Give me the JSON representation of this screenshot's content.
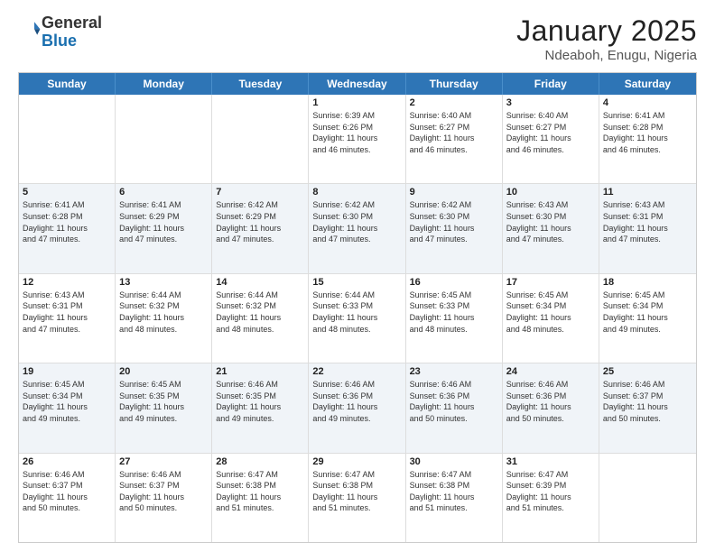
{
  "header": {
    "logo_line1": "General",
    "logo_line2": "Blue",
    "title": "January 2025",
    "subtitle": "Ndeaboh, Enugu, Nigeria"
  },
  "calendar": {
    "days_of_week": [
      "Sunday",
      "Monday",
      "Tuesday",
      "Wednesday",
      "Thursday",
      "Friday",
      "Saturday"
    ],
    "rows": [
      {
        "alt": false,
        "cells": [
          {
            "day": "",
            "info": ""
          },
          {
            "day": "",
            "info": ""
          },
          {
            "day": "",
            "info": ""
          },
          {
            "day": "1",
            "info": "Sunrise: 6:39 AM\nSunset: 6:26 PM\nDaylight: 11 hours\nand 46 minutes."
          },
          {
            "day": "2",
            "info": "Sunrise: 6:40 AM\nSunset: 6:27 PM\nDaylight: 11 hours\nand 46 minutes."
          },
          {
            "day": "3",
            "info": "Sunrise: 6:40 AM\nSunset: 6:27 PM\nDaylight: 11 hours\nand 46 minutes."
          },
          {
            "day": "4",
            "info": "Sunrise: 6:41 AM\nSunset: 6:28 PM\nDaylight: 11 hours\nand 46 minutes."
          }
        ]
      },
      {
        "alt": true,
        "cells": [
          {
            "day": "5",
            "info": "Sunrise: 6:41 AM\nSunset: 6:28 PM\nDaylight: 11 hours\nand 47 minutes."
          },
          {
            "day": "6",
            "info": "Sunrise: 6:41 AM\nSunset: 6:29 PM\nDaylight: 11 hours\nand 47 minutes."
          },
          {
            "day": "7",
            "info": "Sunrise: 6:42 AM\nSunset: 6:29 PM\nDaylight: 11 hours\nand 47 minutes."
          },
          {
            "day": "8",
            "info": "Sunrise: 6:42 AM\nSunset: 6:30 PM\nDaylight: 11 hours\nand 47 minutes."
          },
          {
            "day": "9",
            "info": "Sunrise: 6:42 AM\nSunset: 6:30 PM\nDaylight: 11 hours\nand 47 minutes."
          },
          {
            "day": "10",
            "info": "Sunrise: 6:43 AM\nSunset: 6:30 PM\nDaylight: 11 hours\nand 47 minutes."
          },
          {
            "day": "11",
            "info": "Sunrise: 6:43 AM\nSunset: 6:31 PM\nDaylight: 11 hours\nand 47 minutes."
          }
        ]
      },
      {
        "alt": false,
        "cells": [
          {
            "day": "12",
            "info": "Sunrise: 6:43 AM\nSunset: 6:31 PM\nDaylight: 11 hours\nand 47 minutes."
          },
          {
            "day": "13",
            "info": "Sunrise: 6:44 AM\nSunset: 6:32 PM\nDaylight: 11 hours\nand 48 minutes."
          },
          {
            "day": "14",
            "info": "Sunrise: 6:44 AM\nSunset: 6:32 PM\nDaylight: 11 hours\nand 48 minutes."
          },
          {
            "day": "15",
            "info": "Sunrise: 6:44 AM\nSunset: 6:33 PM\nDaylight: 11 hours\nand 48 minutes."
          },
          {
            "day": "16",
            "info": "Sunrise: 6:45 AM\nSunset: 6:33 PM\nDaylight: 11 hours\nand 48 minutes."
          },
          {
            "day": "17",
            "info": "Sunrise: 6:45 AM\nSunset: 6:34 PM\nDaylight: 11 hours\nand 48 minutes."
          },
          {
            "day": "18",
            "info": "Sunrise: 6:45 AM\nSunset: 6:34 PM\nDaylight: 11 hours\nand 49 minutes."
          }
        ]
      },
      {
        "alt": true,
        "cells": [
          {
            "day": "19",
            "info": "Sunrise: 6:45 AM\nSunset: 6:34 PM\nDaylight: 11 hours\nand 49 minutes."
          },
          {
            "day": "20",
            "info": "Sunrise: 6:45 AM\nSunset: 6:35 PM\nDaylight: 11 hours\nand 49 minutes."
          },
          {
            "day": "21",
            "info": "Sunrise: 6:46 AM\nSunset: 6:35 PM\nDaylight: 11 hours\nand 49 minutes."
          },
          {
            "day": "22",
            "info": "Sunrise: 6:46 AM\nSunset: 6:36 PM\nDaylight: 11 hours\nand 49 minutes."
          },
          {
            "day": "23",
            "info": "Sunrise: 6:46 AM\nSunset: 6:36 PM\nDaylight: 11 hours\nand 50 minutes."
          },
          {
            "day": "24",
            "info": "Sunrise: 6:46 AM\nSunset: 6:36 PM\nDaylight: 11 hours\nand 50 minutes."
          },
          {
            "day": "25",
            "info": "Sunrise: 6:46 AM\nSunset: 6:37 PM\nDaylight: 11 hours\nand 50 minutes."
          }
        ]
      },
      {
        "alt": false,
        "cells": [
          {
            "day": "26",
            "info": "Sunrise: 6:46 AM\nSunset: 6:37 PM\nDaylight: 11 hours\nand 50 minutes."
          },
          {
            "day": "27",
            "info": "Sunrise: 6:46 AM\nSunset: 6:37 PM\nDaylight: 11 hours\nand 50 minutes."
          },
          {
            "day": "28",
            "info": "Sunrise: 6:47 AM\nSunset: 6:38 PM\nDaylight: 11 hours\nand 51 minutes."
          },
          {
            "day": "29",
            "info": "Sunrise: 6:47 AM\nSunset: 6:38 PM\nDaylight: 11 hours\nand 51 minutes."
          },
          {
            "day": "30",
            "info": "Sunrise: 6:47 AM\nSunset: 6:38 PM\nDaylight: 11 hours\nand 51 minutes."
          },
          {
            "day": "31",
            "info": "Sunrise: 6:47 AM\nSunset: 6:39 PM\nDaylight: 11 hours\nand 51 minutes."
          },
          {
            "day": "",
            "info": ""
          }
        ]
      }
    ]
  }
}
